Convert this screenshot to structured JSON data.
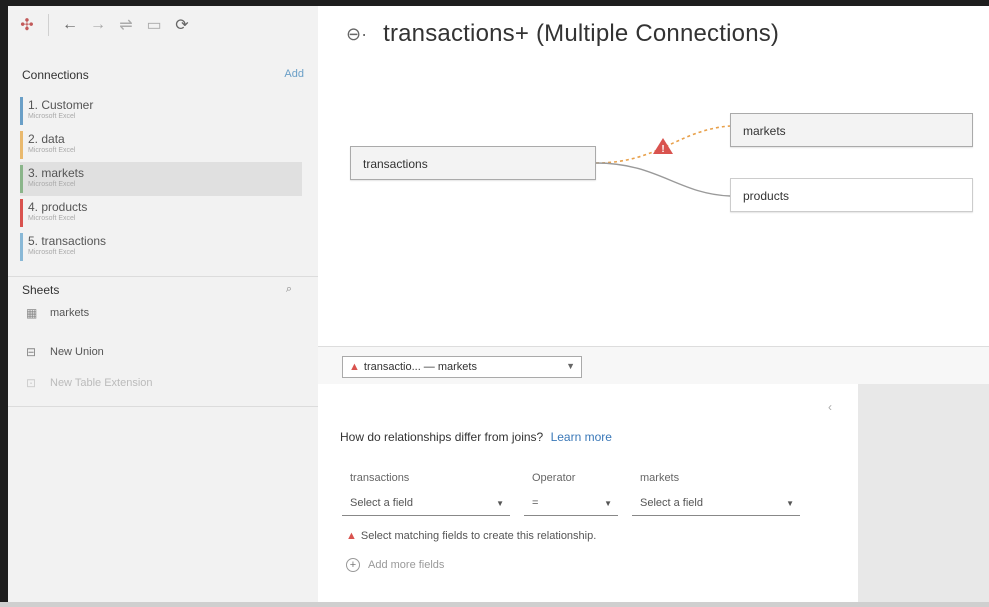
{
  "toolbar": {
    "icons": [
      "tableau-logo-icon",
      "back-arrow-icon",
      "forward-arrow-icon",
      "data-source-icon",
      "pause-icon",
      "refresh-icon"
    ]
  },
  "connections": {
    "title": "Connections",
    "add_label": "Add",
    "items": [
      {
        "label": "1. Customer",
        "sub": "Microsoft Excel",
        "color": "#6a9fc7"
      },
      {
        "label": "2. data",
        "sub": "Microsoft Excel",
        "color": "#e9b96e"
      },
      {
        "label": "3. markets",
        "sub": "Microsoft Excel",
        "color": "#8ab58a"
      },
      {
        "label": "4. products",
        "sub": "Microsoft Excel",
        "color": "#d9534f"
      },
      {
        "label": "5. transactions",
        "sub": "Microsoft Excel",
        "color": "#89b8d6"
      }
    ]
  },
  "sheets": {
    "title": "Sheets",
    "items": [
      {
        "label": "markets",
        "icon": "table-icon"
      },
      {
        "label": "New Union",
        "icon": "union-icon"
      },
      {
        "label": "New Table Extension",
        "icon": "table-extension-icon"
      }
    ]
  },
  "main": {
    "title": "transactions+ (Multiple Connections)",
    "tables": {
      "left": "transactions",
      "top_right": "markets",
      "bottom_right": "products"
    }
  },
  "relationship": {
    "selector_label": "transactio...  —  markets",
    "question": "How do relationships differ from joins?",
    "learn_more": "Learn more",
    "left_field_header": "transactions",
    "operator_header": "Operator",
    "right_field_header": "markets",
    "left_field_value": "Select a field",
    "operator_value": "=",
    "right_field_value": "Select a field",
    "warning": "Select matching fields to create this relationship.",
    "add_more": "Add more fields"
  },
  "colors": {
    "warning": "#d9534f",
    "link": "#3a78b8",
    "dashed_line": "#e8a04a"
  }
}
